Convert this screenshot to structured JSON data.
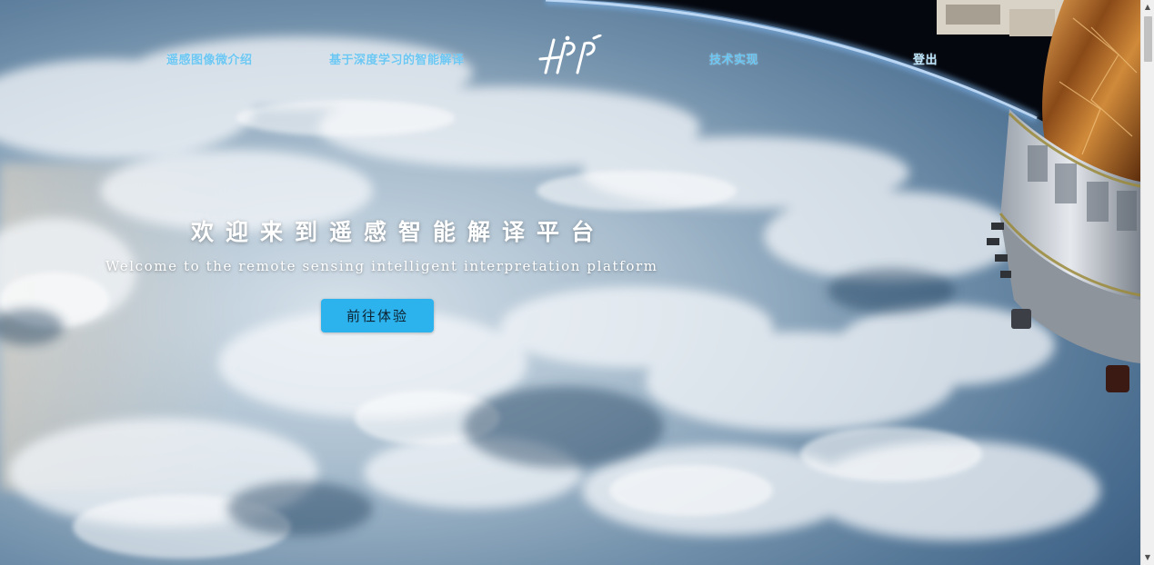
{
  "nav": {
    "items": [
      {
        "label": "遥感图像微介绍"
      },
      {
        "label": "基于深度学习的智能解译"
      },
      {
        "label": "技术实现"
      },
      {
        "label": "登出"
      }
    ],
    "logo_icon": "rsip-logo-icon"
  },
  "hero": {
    "title": "欢迎来到遥感智能解译平台",
    "subtitle": "Welcome to the remote sensing intelligent interpretation platform",
    "cta_label": "前往体验",
    "background": "earth-from-space-with-satellite"
  },
  "colors": {
    "nav_text": "#6cc7f3",
    "cta_background": "#2cb3ee",
    "title_text": "#ffffff"
  },
  "scrollbar": {
    "up_icon": "scroll-up-arrow-icon",
    "down_icon": "scroll-down-arrow-icon"
  }
}
